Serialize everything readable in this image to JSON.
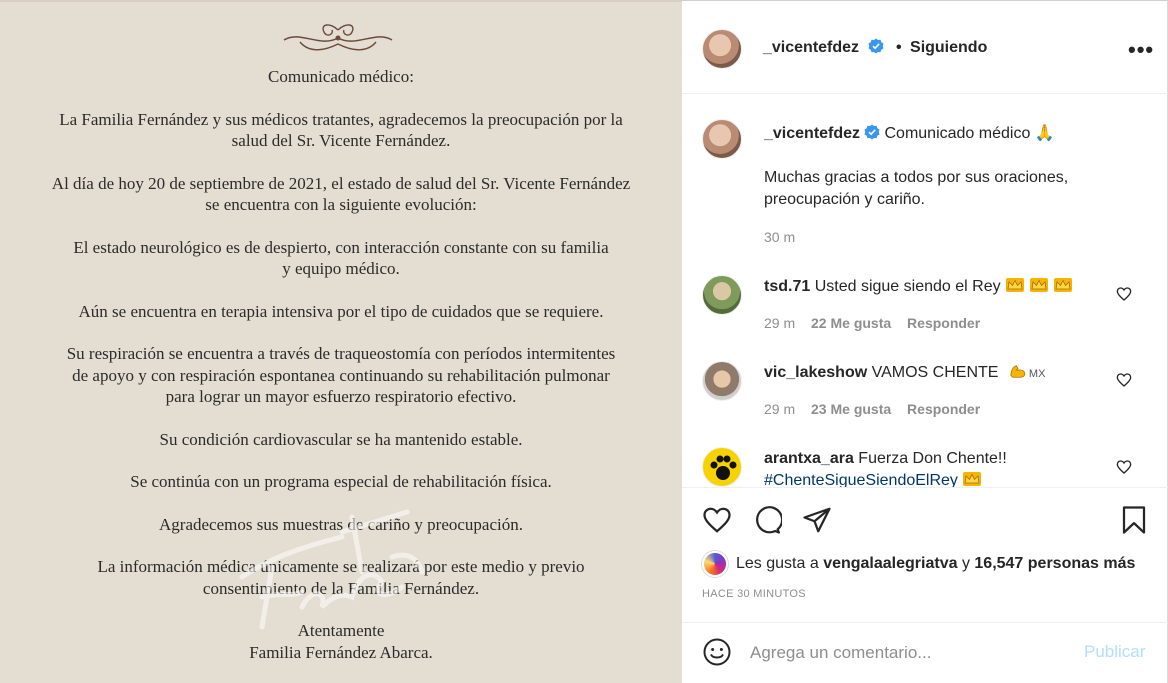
{
  "post_image": {
    "paragraphs": [
      [
        "Comunicado médico:"
      ],
      [
        "La Familia Fernández y sus médicos tratantes, agradecemos la preocupación por la",
        "salud del Sr. Vicente Fernández."
      ],
      [
        "Al día de hoy 20 de septiembre de 2021, el estado de salud del Sr. Vicente Fernández",
        "se encuentra con la siguiente evolución:"
      ],
      [
        "El estado neurológico es de despierto, con interacción constante con su familia",
        "y equipo médico."
      ],
      [
        "Aún se encuentra en terapia intensiva por el tipo de cuidados que se requiere."
      ],
      [
        "Su respiración se encuentra a través de traqueostomía con períodos intermitentes",
        "de apoyo y con respiración espontanea continuando su rehabilitación pulmonar",
        "para lograr un mayor esfuerzo respiratorio efectivo."
      ],
      [
        "Su condición cardiovascular se ha mantenido estable."
      ],
      [
        "Se continúa con un programa especial de rehabilitación física."
      ],
      [
        "Agradecemos sus muestras de cariño y preocupación."
      ],
      [
        "La información médica únicamente se realizará por este medio y previo",
        "consentimiento de la Familia Fernández."
      ],
      [
        "Atentamente",
        "Familia Fernández Abarca."
      ]
    ]
  },
  "header": {
    "username": "_vicentefdez",
    "dot": "•",
    "following_label": "Siguiendo",
    "more_label": "•••"
  },
  "caption": {
    "username": "_vicentefdez",
    "text": "Comunicado médico 🙏",
    "body_line1": "Muchas gracias a todos por sus oraciones,",
    "body_line2": "preocupación y cariño.",
    "time": "30 m"
  },
  "comments": [
    {
      "username": "tsd.71",
      "text": "Usted sigue siendo el Rey",
      "time": "29 m",
      "likes": "22 Me gusta",
      "reply": "Responder"
    },
    {
      "username": "vic_lakeshow",
      "text": "VAMOS CHENTE",
      "suffix": "MX",
      "time": "29 m",
      "likes": "23 Me gusta",
      "reply": "Responder"
    },
    {
      "username": "arantxa_ara",
      "text": "Fuerza Don Chente!!",
      "hashtag": "#ChenteSigueSiendoElRey"
    }
  ],
  "likes": {
    "prefix": "Les gusta a",
    "user": "vengalaalegriatva",
    "conj": "y",
    "count": "16,547 personas más"
  },
  "time_ago": "HACE 30 MINUTOS",
  "comment_box": {
    "placeholder": "Agrega un comentario...",
    "post_label": "Publicar"
  },
  "colors": {
    "verified": "#3897f0",
    "link": "#00376b",
    "post_disabled": "#b2dffc",
    "image_bg": "#e4ddd2"
  }
}
